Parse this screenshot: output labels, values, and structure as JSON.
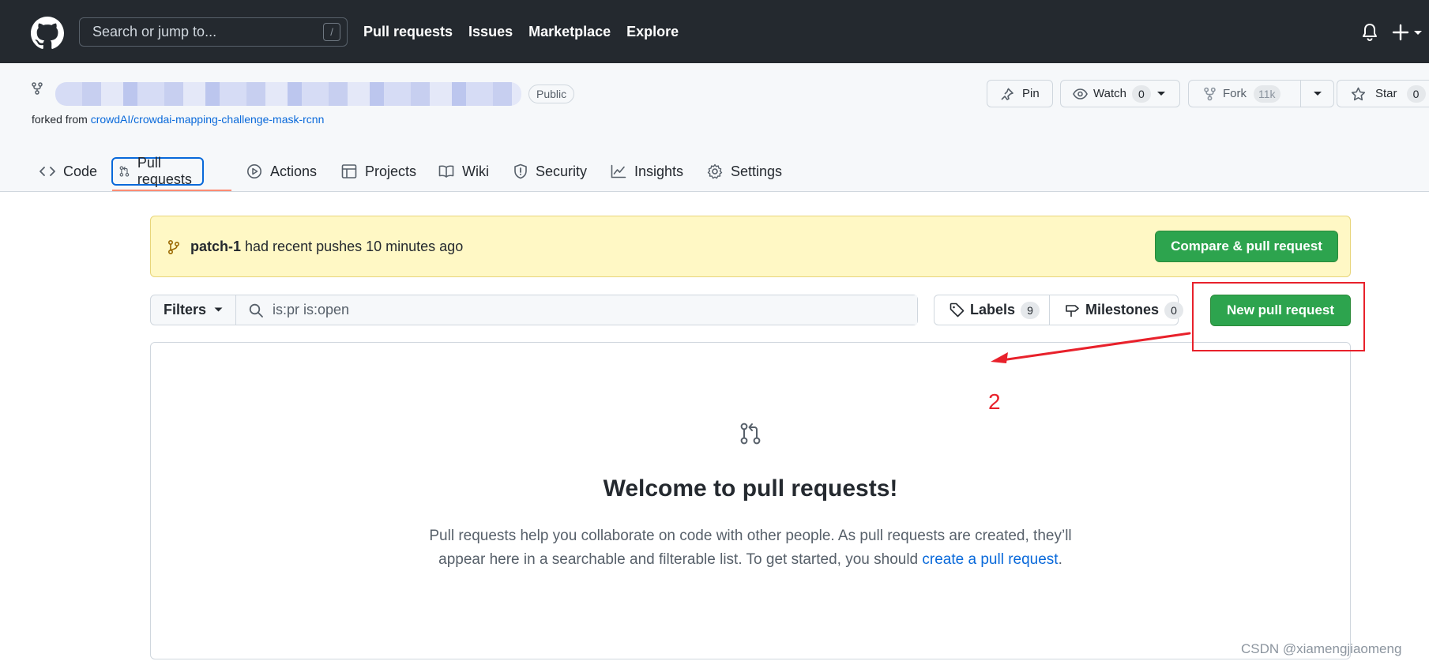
{
  "header": {
    "search_placeholder": "Search or jump to...",
    "search_shortcut": "/",
    "nav": [
      "Pull requests",
      "Issues",
      "Marketplace",
      "Explore"
    ]
  },
  "repo": {
    "visibility": "Public",
    "forked_prefix": "forked from ",
    "forked_source": "crowdAI/crowdai-mapping-challenge-mask-rcnn",
    "actions": {
      "pin": "Pin",
      "watch": "Watch",
      "watch_count": "0",
      "fork": "Fork",
      "fork_count": "11k",
      "star": "Star",
      "star_count": "0"
    },
    "tabs": [
      {
        "label": "Code",
        "icon": "code-icon"
      },
      {
        "label": "Pull requests",
        "icon": "git-pull-request-icon",
        "selected": true
      },
      {
        "label": "Actions",
        "icon": "play-icon"
      },
      {
        "label": "Projects",
        "icon": "table-icon"
      },
      {
        "label": "Wiki",
        "icon": "book-icon"
      },
      {
        "label": "Security",
        "icon": "shield-icon"
      },
      {
        "label": "Insights",
        "icon": "graph-icon"
      },
      {
        "label": "Settings",
        "icon": "gear-icon"
      }
    ]
  },
  "flash": {
    "branch": "patch-1",
    "message": " had recent pushes 10 minutes ago",
    "compare_button": "Compare & pull request"
  },
  "toolbar": {
    "filters_label": "Filters",
    "search_value": "is:pr is:open",
    "labels_label": "Labels",
    "labels_count": "9",
    "milestones_label": "Milestones",
    "milestones_count": "0",
    "new_pr_button": "New pull request"
  },
  "blankslate": {
    "title": "Welcome to pull requests!",
    "line1": "Pull requests help you collaborate on code with other people. As pull requests are created, they’ll",
    "line2_prefix": "appear here in a searchable and filterable list. To get started, you should ",
    "line2_link": "create a pull request",
    "line2_suffix": "."
  },
  "annotation": {
    "step_number": "2",
    "color": "#e8212b"
  },
  "watermark": "CSDN @xiamengjiaomeng",
  "colors": {
    "header_bg": "#24292f",
    "primary_green": "#2da44e",
    "link_blue": "#0969da",
    "flash_bg": "#fff8c5",
    "tab_underline": "#fd8c73"
  }
}
